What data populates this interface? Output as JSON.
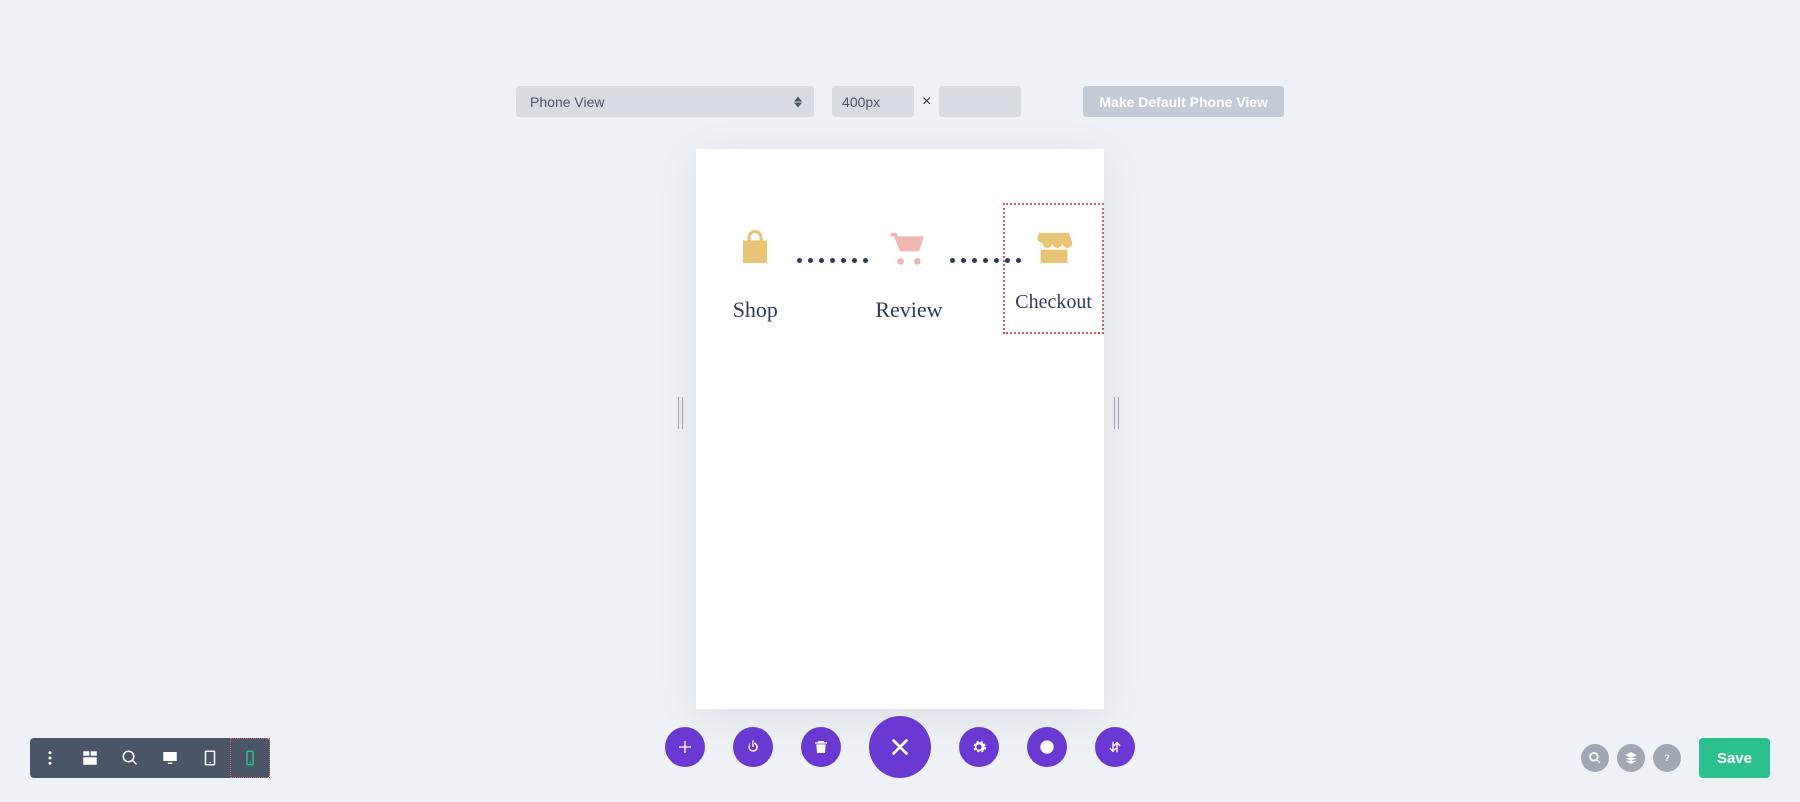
{
  "top": {
    "view_selector": "Phone View",
    "width_value": "400px",
    "height_value": "",
    "default_button": "Make Default Phone View",
    "dimension_separator": "×"
  },
  "steps": {
    "shop": {
      "label": "Shop",
      "icon": "shopping-bag"
    },
    "review": {
      "label": "Review",
      "icon": "shopping-cart"
    },
    "checkout": {
      "label": "Checkout",
      "icon": "store",
      "selected": true
    }
  },
  "action_bar": {
    "add": "plus-icon",
    "power": "power-icon",
    "delete": "trash-icon",
    "close": "close-icon",
    "settings": "gear-icon",
    "history": "clock-icon",
    "layers": "sort-icon"
  },
  "left_toolbar": {
    "items": [
      "more",
      "wireframe",
      "zoom",
      "desktop",
      "tablet",
      "phone"
    ],
    "active": "phone"
  },
  "right_toolbar": {
    "circles": [
      "search",
      "layers",
      "help"
    ],
    "save_label": "Save"
  },
  "colors": {
    "accent_purple": "#6b39d1",
    "save_green": "#2bc08e",
    "step_text": "#2d3b5a",
    "icon_bag": "#e9c476",
    "icon_cart": "#f0b7b2",
    "icon_store": "#e9c476",
    "selected_border": "#d85a5a"
  }
}
